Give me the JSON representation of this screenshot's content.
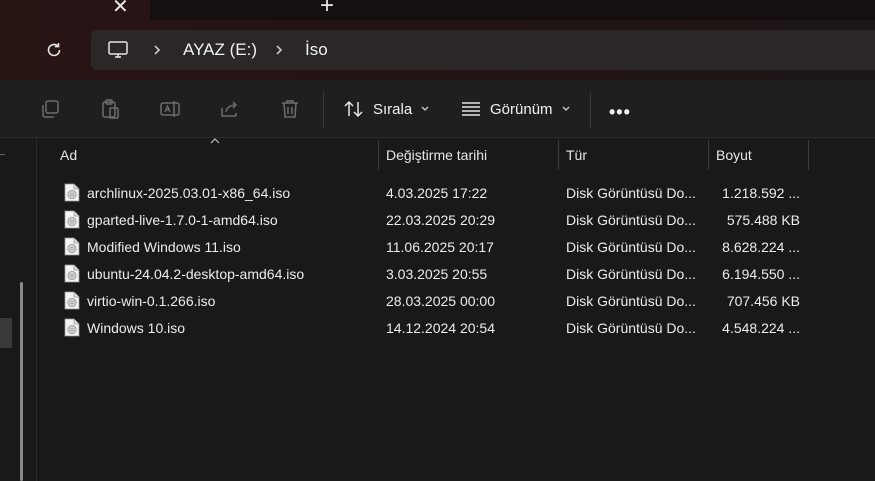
{
  "tabbar": {
    "close_glyph": "✕",
    "new_glyph": "+"
  },
  "address": {
    "icon": "computer-icon",
    "segments": [
      "AYAZ (E:)",
      "İso"
    ]
  },
  "toolbar": {
    "icons": [
      "copy-icon",
      "paste-icon",
      "rename-icon",
      "share-icon",
      "delete-icon"
    ],
    "sort_label": "Sırala",
    "view_label": "Görünüm",
    "more_label": "•••"
  },
  "columns": {
    "name": "Ad",
    "date": "Değiştirme tarihi",
    "type": "Tür",
    "size": "Boyut"
  },
  "files": [
    {
      "name": "archlinux-2025.03.01-x86_64.iso",
      "date": "4.03.2025 17:22",
      "type": "Disk Görüntüsü Do...",
      "size": "1.218.592 ..."
    },
    {
      "name": "gparted-live-1.7.0-1-amd64.iso",
      "date": "22.03.2025 20:29",
      "type": "Disk Görüntüsü Do...",
      "size": "575.488 KB"
    },
    {
      "name": "Modified Windows 11.iso",
      "date": "11.06.2025 20:17",
      "type": "Disk Görüntüsü Do...",
      "size": "8.628.224 ..."
    },
    {
      "name": "ubuntu-24.04.2-desktop-amd64.iso",
      "date": "3.03.2025 20:55",
      "type": "Disk Görüntüsü Do...",
      "size": "6.194.550 ..."
    },
    {
      "name": "virtio-win-0.1.266.iso",
      "date": "28.03.2025 00:00",
      "type": "Disk Görüntüsü Do...",
      "size": "707.456 KB"
    },
    {
      "name": "Windows 10.iso",
      "date": "14.12.2024 20:54",
      "type": "Disk Görüntüsü Do...",
      "size": "4.548.224 ..."
    }
  ]
}
